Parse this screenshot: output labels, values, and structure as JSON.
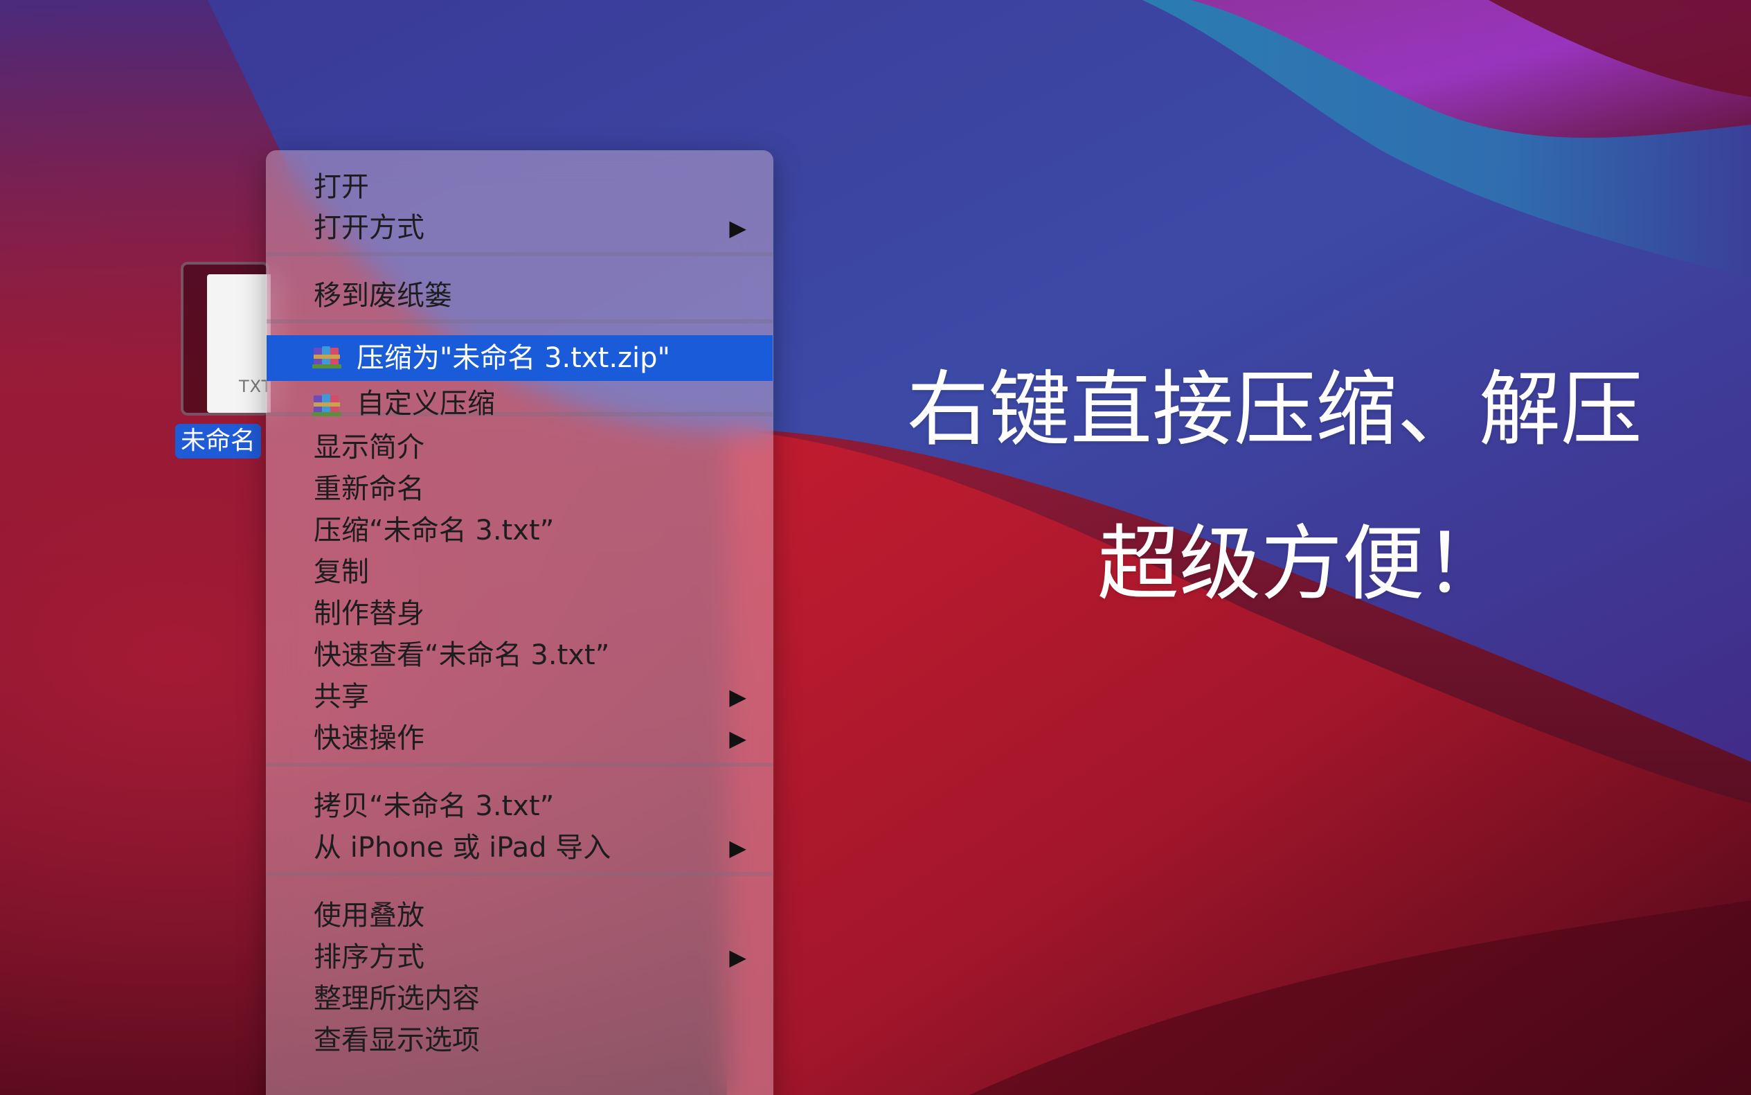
{
  "desktop": {
    "file": {
      "name": "未命名",
      "ext_label": "TXT"
    }
  },
  "context_menu": {
    "items": [
      {
        "label": "打开"
      },
      {
        "label": "打开方式",
        "submenu": true
      },
      {
        "label": "移到废纸篓"
      },
      {
        "label": "压缩为\"未命名 3.txt.zip\"",
        "icon": "winrar-archive-icon",
        "highlighted": true
      },
      {
        "label": "自定义压缩",
        "icon": "winrar-archive-icon"
      },
      {
        "label": "显示简介"
      },
      {
        "label": "重新命名"
      },
      {
        "label": "压缩“未命名 3.txt”"
      },
      {
        "label": "复制"
      },
      {
        "label": "制作替身"
      },
      {
        "label": "快速查看“未命名 3.txt”"
      },
      {
        "label": "共享",
        "submenu": true
      },
      {
        "label": "快速操作",
        "submenu": true
      },
      {
        "label": "拷贝“未命名 3.txt”"
      },
      {
        "label": "从 iPhone 或 iPad 导入",
        "submenu": true
      },
      {
        "label": "使用叠放"
      },
      {
        "label": "排序方式",
        "submenu": true
      },
      {
        "label": "整理所选内容"
      },
      {
        "label": "查看显示选项"
      }
    ],
    "submenu_arrow": "▶"
  },
  "promo": {
    "line1": "右键直接压缩、解压",
    "line2": "超级方便！"
  },
  "colors": {
    "highlight": "#1a5bd9",
    "selection_label": "#1f5bd6"
  }
}
